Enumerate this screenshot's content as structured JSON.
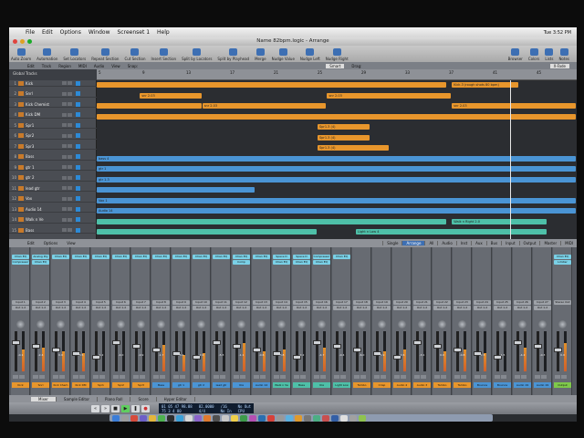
{
  "menubar": {
    "items": [
      "File",
      "Edit",
      "Options",
      "Window",
      "Screenset 1",
      "Help"
    ],
    "clock": "Tue 3:52 PM"
  },
  "window": {
    "title": "Name 82bpm.logic - Arrange"
  },
  "toolbar": {
    "left": [
      "Auto Zoom",
      "Automation",
      "Set Locators",
      "Repeat Section",
      "Cut Section",
      "Insert Section"
    ],
    "middle": [
      "Split by Locators",
      "Split by Playhead",
      "Merge",
      "Nudge Value",
      "Nudge Left",
      "Nudge Right"
    ],
    "right": [
      "Browser",
      "Colors",
      "Lists",
      "Notes"
    ]
  },
  "arrange": {
    "menus": [
      "Edit",
      "Track",
      "Region",
      "MIDI",
      "Audio",
      "View"
    ],
    "snap_label": "Snap:",
    "snap_value": "Smart",
    "drag_label": "Drag:",
    "drag_value": "X-Fade",
    "global_tracks": "Global Tracks",
    "ruler": [
      "5",
      "9",
      "13",
      "17",
      "21",
      "25",
      "29",
      "33",
      "37",
      "41",
      "45"
    ],
    "tracks": [
      {
        "num": "1",
        "name": "Kick"
      },
      {
        "num": "2",
        "name": "Snrl"
      },
      {
        "num": "3",
        "name": "Kick Chemist"
      },
      {
        "num": "4",
        "name": "Kick DM"
      },
      {
        "num": "5",
        "name": "Spr1"
      },
      {
        "num": "6",
        "name": "Spr2"
      },
      {
        "num": "7",
        "name": "Spr3"
      },
      {
        "num": "8",
        "name": "Bass"
      },
      {
        "num": "9",
        "name": "gtr 1"
      },
      {
        "num": "10",
        "name": "gtr 2"
      },
      {
        "num": "11",
        "name": "lead gtr"
      },
      {
        "num": "12",
        "name": "Vox"
      },
      {
        "num": "13",
        "name": "Audio 14"
      },
      {
        "num": "14",
        "name": "Walk n Ve"
      },
      {
        "num": "15",
        "name": "Bass"
      }
    ],
    "regions": [
      {
        "track": 0,
        "start": 0.0,
        "end": 0.73,
        "color": "#e8962c",
        "label": ""
      },
      {
        "track": 0,
        "start": 0.74,
        "end": 0.88,
        "color": "#e8962c",
        "label": "Kick.3 (rough shots 80 bpm)"
      },
      {
        "track": 1,
        "start": 0.09,
        "end": 0.22,
        "color": "#e8962c",
        "label": "snr 2.03"
      },
      {
        "track": 1,
        "start": 0.48,
        "end": 0.74,
        "color": "#e8962c",
        "label": "snr 2.03"
      },
      {
        "track": 2,
        "start": 0.0,
        "end": 0.22,
        "color": "#e8962c",
        "label": ""
      },
      {
        "track": 2,
        "start": 0.22,
        "end": 0.48,
        "color": "#e8962c",
        "label": "snr 2.03"
      },
      {
        "track": 2,
        "start": 0.74,
        "end": 1.0,
        "color": "#e8962c",
        "label": "snr 2.03"
      },
      {
        "track": 3,
        "start": 0.0,
        "end": 1.0,
        "color": "#e8962c",
        "label": ""
      },
      {
        "track": 4,
        "start": 0.46,
        "end": 0.57,
        "color": "#e8962c",
        "label": "Spr1.3 (4)"
      },
      {
        "track": 5,
        "start": 0.46,
        "end": 0.57,
        "color": "#e8962c",
        "label": "Spr1.3 (4)"
      },
      {
        "track": 6,
        "start": 0.46,
        "end": 0.61,
        "color": "#e8962c",
        "label": "Spr1.3 (4)"
      },
      {
        "track": 7,
        "start": 0.0,
        "end": 1.0,
        "color": "#4a94d4",
        "label": "bass 4"
      },
      {
        "track": 8,
        "start": 0.0,
        "end": 1.0,
        "color": "#4a94d4",
        "label": "gtr 1"
      },
      {
        "track": 9,
        "start": 0.0,
        "end": 1.0,
        "color": "#4a94d4",
        "label": "gtr 1.3"
      },
      {
        "track": 10,
        "start": 0.0,
        "end": 0.33,
        "color": "#4a94d4",
        "label": ""
      },
      {
        "track": 11,
        "start": 0.0,
        "end": 1.0,
        "color": "#4a94d4",
        "label": "Vox 1"
      },
      {
        "track": 12,
        "start": 0.0,
        "end": 1.0,
        "color": "#4a94d4",
        "label": "Audio 14"
      },
      {
        "track": 13,
        "start": 0.0,
        "end": 0.73,
        "color": "#4ec0a8",
        "label": ""
      },
      {
        "track": 13,
        "start": 0.74,
        "end": 0.94,
        "color": "#4ec0a8",
        "label": "Walk n Right 2.0"
      },
      {
        "track": 14,
        "start": 0.0,
        "end": 0.46,
        "color": "#4ec0a8",
        "label": ""
      },
      {
        "track": 14,
        "start": 0.54,
        "end": 0.94,
        "color": "#4ec0a8",
        "label": "Light n Low 4"
      }
    ]
  },
  "mixer": {
    "menus": [
      "Edit",
      "Options",
      "View"
    ],
    "filters": [
      "Single",
      "Arrange",
      "All",
      "Audio",
      "Inst",
      "Aux",
      "Bus",
      "Input",
      "Output",
      "Master",
      "MIDI"
    ],
    "active_filter": "Arrange",
    "strips": [
      {
        "name": "Kick",
        "color": "#e8962c",
        "plugins": [
          "Chan EQ",
          "Compressor"
        ],
        "io": [
          "Input 1",
          "Out 1-2"
        ],
        "gain": "-0.1",
        "level": 0.55
      },
      {
        "name": "Snrl",
        "color": "#e8962c",
        "plugins": [
          "Analog Dly",
          "Chan EQ"
        ],
        "io": [
          "Input 2",
          "Out 1-2"
        ],
        "gain": "-2.4",
        "level": 0.6
      },
      {
        "name": "Kick Chem",
        "color": "#e8962c",
        "plugins": [
          "Chan EQ"
        ],
        "io": [
          "Input 3",
          "Out 1-2"
        ],
        "gain": "0.0",
        "level": 0.5
      },
      {
        "name": "Kick DM",
        "color": "#e8962c",
        "plugins": [
          "Chan EQ"
        ],
        "io": [
          "Input 4",
          "Out 1-2"
        ],
        "gain": "-3.5",
        "level": 0.45
      },
      {
        "name": "Spr1",
        "color": "#e8962c",
        "plugins": [
          "Chan EQ"
        ],
        "io": [
          "Input 5",
          "Out 1-2"
        ],
        "gain": "-1.2",
        "level": 0.0
      },
      {
        "name": "Spr2",
        "color": "#e8962c",
        "plugins": [
          "Chan EQ"
        ],
        "io": [
          "Input 6",
          "Out 1-2"
        ],
        "gain": "-4.0",
        "level": 0.0
      },
      {
        "name": "Spr3",
        "color": "#e8962c",
        "plugins": [
          "Chan EQ"
        ],
        "io": [
          "Input 7",
          "Out 1-2"
        ],
        "gain": "-0.9",
        "level": 0.0
      },
      {
        "name": "Bass",
        "color": "#4a94d4",
        "plugins": [
          "Chan EQ"
        ],
        "io": [
          "Input 8",
          "Out 1-2"
        ],
        "gain": "-1.7",
        "level": 0.65
      },
      {
        "name": "gtr 1",
        "color": "#4a94d4",
        "plugins": [
          "Chan EQ"
        ],
        "io": [
          "Input 9",
          "Out 1-2"
        ],
        "gain": "-6.1",
        "level": 0.4
      },
      {
        "name": "gtr 2",
        "color": "#4a94d4",
        "plugins": [
          "Chan EQ"
        ],
        "io": [
          "Input 10",
          "Out 1-2"
        ],
        "gain": "-2.0",
        "level": 0.45
      },
      {
        "name": "lead gtr",
        "color": "#4a94d4",
        "plugins": [
          "Chan EQ"
        ],
        "io": [
          "Input 11",
          "Out 1-2"
        ],
        "gain": "-5.3",
        "level": 0.0
      },
      {
        "name": "Vox",
        "color": "#4a94d4",
        "plugins": [
          "Chan EQ",
          "Comp"
        ],
        "io": [
          "Input 12",
          "Out 1-2"
        ],
        "gain": "-1.1",
        "level": 0.7
      },
      {
        "name": "Audio 14",
        "color": "#4a94d4",
        "plugins": [
          "Chan EQ"
        ],
        "io": [
          "Input 13",
          "Out 1-2"
        ],
        "gain": "-0.6",
        "level": 0.5
      },
      {
        "name": "Walk n Ve",
        "color": "#4ec0a8",
        "plugins": [
          "Space D",
          "Chan EQ"
        ],
        "io": [
          "Input 14",
          "Out 1-2"
        ],
        "gain": "-3.8",
        "level": 0.55
      },
      {
        "name": "Bass",
        "color": "#4ec0a8",
        "plugins": [
          "Space D",
          "Chan EQ"
        ],
        "io": [
          "Input 15",
          "Out 1-2"
        ],
        "gain": "-2.2",
        "level": 0.0
      },
      {
        "name": "Vox",
        "color": "#4ec0a8",
        "plugins": [
          "Compressor",
          "Chan EQ"
        ],
        "io": [
          "Input 16",
          "Out 1-2"
        ],
        "gain": "-4.7",
        "level": 0.6
      },
      {
        "name": "Light Low",
        "color": "#4ec0a8",
        "plugins": [
          "Chan EQ"
        ],
        "io": [
          "Input 17",
          "Out 1-2"
        ],
        "gain": "-0.4",
        "level": 0.0
      },
      {
        "name": "Tambo",
        "color": "#e8962c",
        "plugins": [],
        "io": [
          "Input 18",
          "Out 1-2"
        ],
        "gain": "-6.0",
        "level": 0.0
      },
      {
        "name": "Crisp",
        "color": "#e8962c",
        "plugins": [],
        "io": [
          "Input 19",
          "Out 1-2"
        ],
        "gain": "-1.9",
        "level": 0.5
      },
      {
        "name": "Audio 4",
        "color": "#e8962c",
        "plugins": [],
        "io": [
          "Input 20",
          "Out 1-2"
        ],
        "gain": "-2.6",
        "level": 0.55
      },
      {
        "name": "Audio 3",
        "color": "#e8962c",
        "plugins": [],
        "io": [
          "Input 21",
          "Out 1-2"
        ],
        "gain": "-3.1",
        "level": 0.0
      },
      {
        "name": "Tambo",
        "color": "#e8962c",
        "plugins": [],
        "io": [
          "Input 22",
          "Out 1-2"
        ],
        "gain": "0.0",
        "level": 0.5
      },
      {
        "name": "Tambo",
        "color": "#e8962c",
        "plugins": [],
        "io": [
          "Input 23",
          "Out 1-2"
        ],
        "gain": "-0.8",
        "level": 0.55
      },
      {
        "name": "Bounce",
        "color": "#4a94d4",
        "plugins": [],
        "io": [
          "Input 24",
          "Out 1-2"
        ],
        "gain": "-2.3",
        "level": 0.45
      },
      {
        "name": "Bounce",
        "color": "#4a94d4",
        "plugins": [],
        "io": [
          "Input 25",
          "Out 1-2"
        ],
        "gain": "-1.5",
        "level": 0.0
      },
      {
        "name": "Audio 19",
        "color": "#4a94d4",
        "plugins": [],
        "io": [
          "Input 26",
          "Out 1-2"
        ],
        "gain": "-4.2",
        "level": 0.6
      },
      {
        "name": "Audio 19",
        "color": "#4a94d4",
        "plugins": [],
        "io": [
          "Input 27",
          "Out 1-2"
        ],
        "gain": "-0.3",
        "level": 0.0
      },
      {
        "name": "Output",
        "color": "#7ec84a",
        "plugins": [
          "Chan EQ",
          "Limiter"
        ],
        "io": [
          "Stereo Out"
        ],
        "gain": "0.0",
        "level": 0.7
      }
    ]
  },
  "bottom_tabs": [
    "Mixer",
    "Sample Editor",
    "Piano Roll",
    "Score",
    "Hyper Editor"
  ],
  "transport": {
    "position": "01 05 47 98.88",
    "bars": "75 3 4 80",
    "tempo": "82.0000",
    "signature": "4/4",
    "division": "/16",
    "in_label": "No In",
    "out_label": "No Out",
    "cpu_label": "CPU"
  },
  "dock_colors": [
    "#3b7dd8",
    "#9c9c9c",
    "#d64b3c",
    "#6c5fc7",
    "#e3b53b",
    "#4db24f",
    "#2c2c2c",
    "#3aa0d8",
    "#d8d8d8",
    "#8a63c9",
    "#e07a2e",
    "#4f4f4f",
    "#c7c7c7",
    "#f0d04a",
    "#3d9a4a",
    "#b54fb2",
    "#2a6fb0",
    "#d7413a",
    "#999",
    "#5bb1e0",
    "#e09a2c",
    "#777",
    "#4cae84",
    "#c94f4f",
    "#335fa6",
    "#dfdfdf",
    "#a1a1a1",
    "#8fc34f"
  ]
}
